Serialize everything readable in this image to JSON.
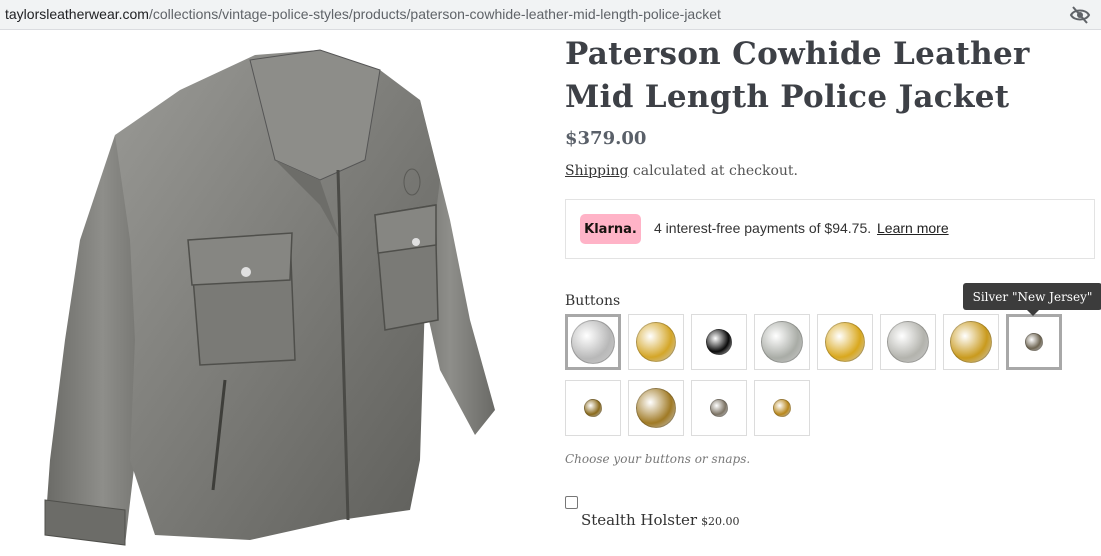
{
  "browser": {
    "url_domain": "taylorsleatherwear.com",
    "url_path": "/collections/vintage-police-styles/products/paterson-cowhide-leather-mid-length-police-jacket",
    "eye_icon": "eye-off-icon"
  },
  "product": {
    "title_line1": "Paterson Cowhide Leather",
    "title_line2": "Mid Length Police Jacket",
    "price": "$379.00",
    "shipping_link": "Shipping",
    "shipping_text": " calculated at checkout.",
    "image_icon": "leather-jacket-image"
  },
  "klarna": {
    "badge": "Klarna.",
    "text": "4 interest-free payments of $94.75.",
    "learn_more": "Learn more",
    "badge_color": "#ffb3c7"
  },
  "options": {
    "buttons_label": "Buttons",
    "tooltip": "Silver \"New Jersey\"",
    "hint": "Choose your buttons or snaps.",
    "swatches": [
      {
        "name": "silver-d-button",
        "color": "#b8b8b8"
      },
      {
        "name": "gold-d-button",
        "color": "#d4a628"
      },
      {
        "name": "black-button",
        "color": "#0a0a0a"
      },
      {
        "name": "silver-s-button",
        "color": "#a9aca6"
      },
      {
        "name": "gold-s-button",
        "color": "#d9a81e"
      },
      {
        "name": "silver-pd-button",
        "color": "#b3b3ad"
      },
      {
        "name": "gold-pd-button",
        "color": "#c99a1d"
      },
      {
        "name": "silver-new-jersey-button",
        "color": "#6e6552"
      },
      {
        "name": "brass-small-button",
        "color": "#8a6a1c"
      },
      {
        "name": "gold-eagle-button",
        "color": "#a07a25"
      },
      {
        "name": "silver-small-button",
        "color": "#7d7465"
      },
      {
        "name": "gold-small-button",
        "color": "#b8871c"
      }
    ]
  },
  "addon": {
    "holster_label": "Stealth Holster",
    "holster_price": "$20.00"
  }
}
